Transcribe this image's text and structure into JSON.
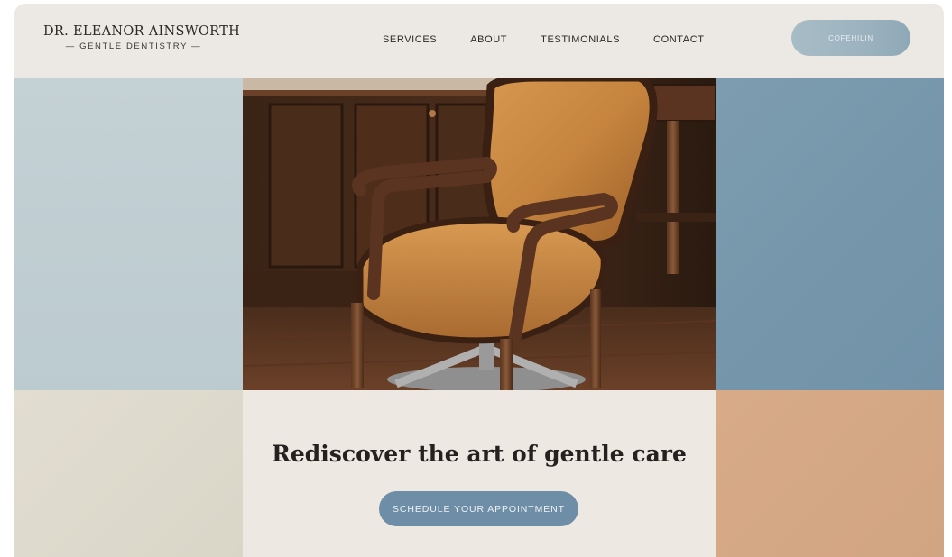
{
  "brand": {
    "name": "DR. ELEANOR AINSWORTH",
    "tagline": "— GENTLE DENTISTRY —"
  },
  "nav": {
    "items": [
      {
        "label": "SERVICES"
      },
      {
        "label": "ABOUT"
      },
      {
        "label": "TESTIMONIALS"
      },
      {
        "label": "CONTACT"
      }
    ]
  },
  "header": {
    "cta_label": "COFEHILIN"
  },
  "hero": {
    "image_alt": "Leather upholstered wooden armchair",
    "headline": "Rediscover the art of gentle care",
    "button_label": "SCHEDULE YOUR APPOINTMENT"
  },
  "colors": {
    "accent": "#6d8ea6",
    "panel_blue_light": "#c4d1d5",
    "panel_blue_dark": "#7697ab",
    "panel_cream": "#e2ddd1",
    "panel_peach": "#d8aa88",
    "background": "#ece7e1"
  }
}
